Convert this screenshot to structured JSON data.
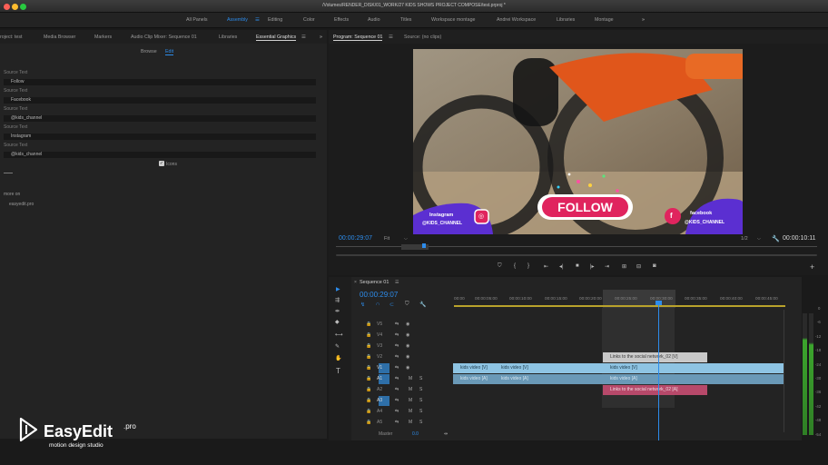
{
  "window": {
    "title": "/Volumes/RENDER_DISK/01_WORK/27 KIDS SHOWS PROJECT COMPOSE/test.prproj *"
  },
  "workspaces": [
    "All Panels",
    "Assembly",
    "Editing",
    "Color",
    "Effects",
    "Audio",
    "Titles",
    "Workspace montage",
    "Andrei Workspace",
    "Libraries",
    "Montage"
  ],
  "left_tabs": [
    "roject: test",
    "Media Browser",
    "Markers",
    "Audio Clip Mixer: Sequence 01",
    "Libraries",
    "Essential Graphics"
  ],
  "eg": {
    "browse": "Browse",
    "edit": "Edit",
    "icons_label": "Icons",
    "more_on": "more on",
    "site": "easyedit.pro"
  },
  "source_fields": [
    {
      "label": "Source Text",
      "value": "Follow"
    },
    {
      "label": "Source Text",
      "value": "Facebook"
    },
    {
      "label": "Source Text",
      "value": "@kids_channel"
    },
    {
      "label": "Source Text",
      "value": "Instagram"
    },
    {
      "label": "Source Text",
      "value": "@kids_channel"
    }
  ],
  "monitor": {
    "tab_program": "Program: Sequence 01",
    "tab_source": "Source: (no clips)",
    "timecode": "00:00:29:07",
    "fit": "Fit",
    "quality": "1/2",
    "duration": "00:00:10:11"
  },
  "overlay": {
    "follow": "FOLLOW",
    "instagram_title": "Instagram",
    "instagram_handle": "@KIDS_CHANNEL",
    "facebook_title": "facebook",
    "facebook_handle": "@KIDS_CHANNEL"
  },
  "sequence": {
    "name": "Sequence 01",
    "timecode": "00:00:29:07"
  },
  "ruler": [
    "00:00",
    "00:00:05:00",
    "00:00:10:00",
    "00:00:15:00",
    "00:00:20:00",
    "00:00:25:00",
    "00:00:30:00",
    "00:00:35:00",
    "00:00:40:00",
    "00:00:45:00"
  ],
  "tracks": [
    "V5",
    "V4",
    "V3",
    "V2",
    "V1",
    "A1",
    "A2",
    "A3",
    "A4",
    "A5",
    "Master"
  ],
  "master_value": "0.0",
  "clips": {
    "v1_a": "kids video [V]",
    "v1_b": "kids video [V]",
    "v1_c": "kids video [V]",
    "v2": "Links to the social network_02 [V]",
    "a1_a": "kids video [A]",
    "a1_b": "kids video [A]",
    "a1_c": "kids video [A]",
    "a2": "Links to the social network_02 [A]"
  },
  "meter_scale": [
    "0",
    "-6",
    "-12",
    "-18",
    "-24",
    "-30",
    "-36",
    "-42",
    "-48",
    "-54"
  ],
  "brand": {
    "name": "EasyEdit",
    "suffix": ".pro",
    "tagline": "motion design studio"
  }
}
